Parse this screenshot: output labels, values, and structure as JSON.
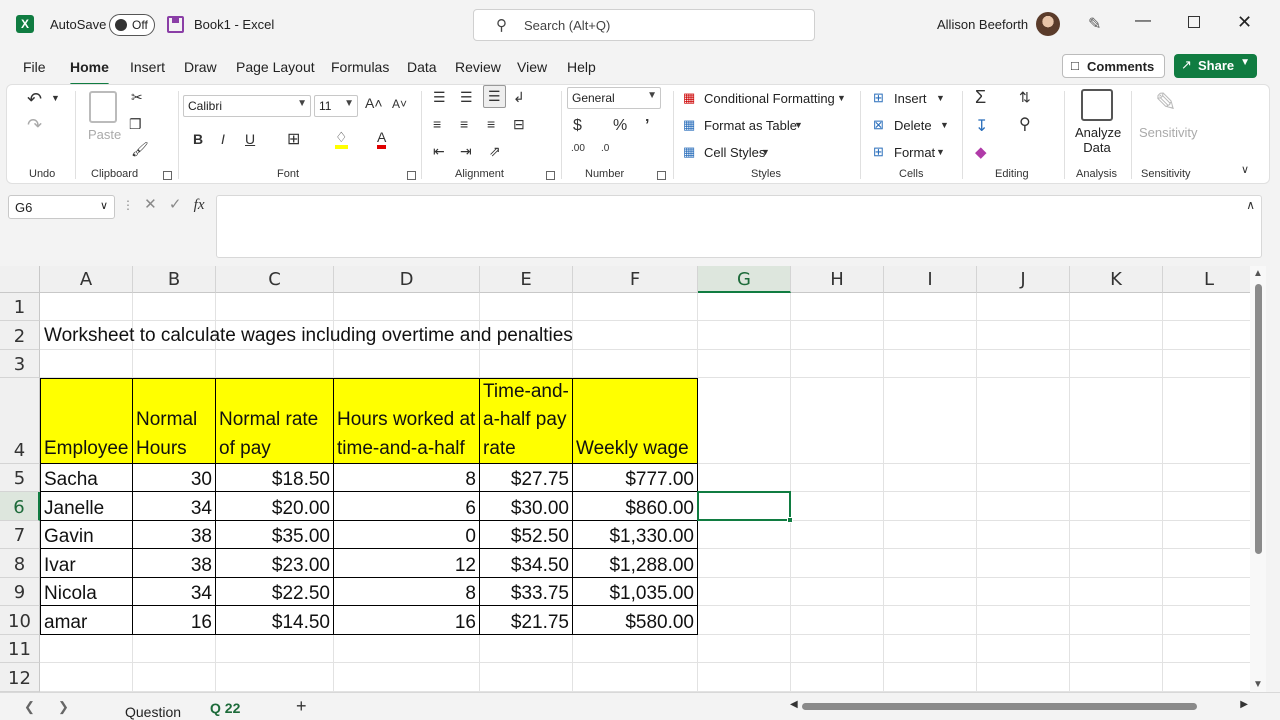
{
  "titlebar": {
    "autosave_label": "AutoSave",
    "autosave_state": "Off",
    "doc_title": "Book1  -  Excel",
    "search_placeholder": "Search (Alt+Q)",
    "user_name": "Allison Beeforth"
  },
  "tabs": [
    "File",
    "Home",
    "Insert",
    "Draw",
    "Page Layout",
    "Formulas",
    "Data",
    "Review",
    "View",
    "Help"
  ],
  "active_tab": "Home",
  "actions": {
    "comments": "Comments",
    "share": "Share"
  },
  "ribbon": {
    "groups": {
      "undo": "Undo",
      "clipboard": "Clipboard",
      "font": "Font",
      "alignment": "Alignment",
      "number": "Number",
      "styles": "Styles",
      "cells": "Cells",
      "editing": "Editing",
      "analysis": "Analysis",
      "sensitivity": "Sensitivity"
    },
    "paste": "Paste",
    "font_name": "Calibri",
    "font_size": "11",
    "number_format": "General",
    "conditional_formatting": "Conditional Formatting",
    "format_as_table": "Format as Table",
    "cell_styles": "Cell Styles",
    "insert": "Insert",
    "delete": "Delete",
    "format": "Format",
    "analyze_data": "Analyze Data",
    "sensitivity_btn": "Sensitivity"
  },
  "formula_bar": {
    "name_box": "G6",
    "formula": ""
  },
  "columns": [
    "A",
    "B",
    "C",
    "D",
    "E",
    "F",
    "G",
    "H",
    "I",
    "J",
    "K",
    "L"
  ],
  "selected_column": "G",
  "rows": [
    "1",
    "2",
    "3",
    "4",
    "5",
    "6",
    "7",
    "8",
    "9",
    "10",
    "11",
    "12"
  ],
  "selected_row": "6",
  "sheet": {
    "title": "Worksheet to calculate wages including overtime and penalties",
    "headers": [
      "Employee",
      "Normal Hours",
      "Normal rate of pay",
      "Hours worked at time-and-a-half",
      "Time-and-a-half pay rate",
      "Weekly wage"
    ],
    "data": [
      [
        "Sacha",
        "30",
        "$18.50",
        "8",
        "$27.75",
        "$777.00"
      ],
      [
        "Janelle",
        "34",
        "$20.00",
        "6",
        "$30.00",
        "$860.00"
      ],
      [
        "Gavin",
        "38",
        "$35.00",
        "0",
        "$52.50",
        "$1,330.00"
      ],
      [
        "Ivar",
        "38",
        "$23.00",
        "12",
        "$34.50",
        "$1,288.00"
      ],
      [
        "Nicola",
        "34",
        "$22.50",
        "8",
        "$33.75",
        "$1,035.00"
      ],
      [
        "amar",
        "16",
        "$14.50",
        "16",
        "$21.75",
        "$580.00"
      ]
    ]
  },
  "sheet_tabs": [
    "Question",
    "Q 22"
  ],
  "active_sheet": "Q 22",
  "colors": {
    "accent": "#107c41",
    "header_fill": "#ffff00"
  }
}
